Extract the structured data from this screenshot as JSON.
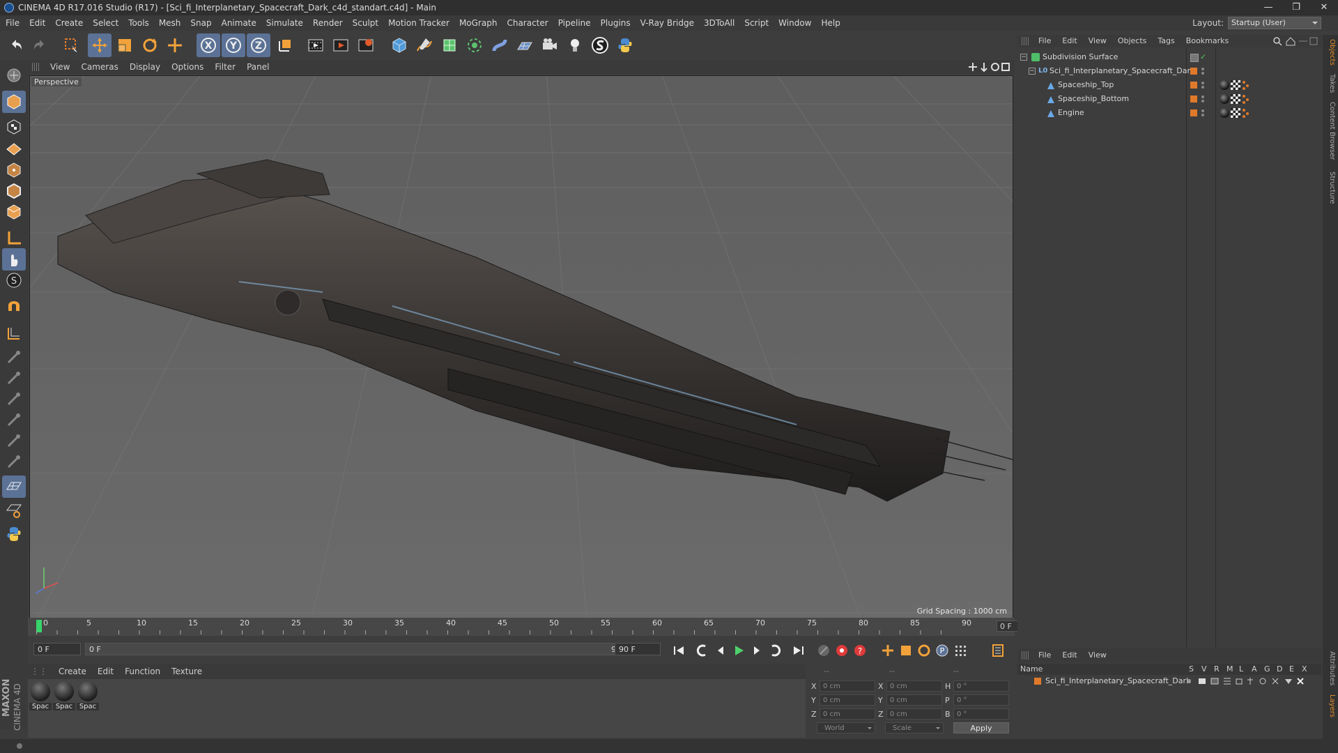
{
  "window": {
    "title": "CINEMA 4D R17.016 Studio (R17) - [Sci_fi_Interplanetary_Spacecraft_Dark_c4d_standart.c4d] - Main",
    "minimize_glyph": "—",
    "restore_glyph": "❐",
    "close_glyph": "✕"
  },
  "menu": [
    "File",
    "Edit",
    "Create",
    "Select",
    "Tools",
    "Mesh",
    "Snap",
    "Animate",
    "Simulate",
    "Render",
    "Sculpt",
    "Motion Tracker",
    "MoGraph",
    "Character",
    "Pipeline",
    "Plugins",
    "V-Ray Bridge",
    "3DToAll",
    "Script",
    "Window",
    "Help"
  ],
  "layout": {
    "label": "Layout:",
    "value": "Startup (User)"
  },
  "toolbar": {
    "axis_x": "X",
    "axis_y": "Y",
    "axis_z": "Z",
    "icons": [
      "undo-icon",
      "redo-icon",
      "live-selection-icon",
      "move-icon",
      "scale-icon",
      "rotate-icon",
      "last-tool-icon",
      "x-axis-icon",
      "y-axis-icon",
      "z-axis-icon",
      "coordinate-system-icon",
      "render-view-icon",
      "render-picture-viewer-icon",
      "edit-render-settings-icon",
      "cube-icon",
      "pen-spline-icon",
      "subdivision-surface-icon",
      "array-icon",
      "deformer-icon",
      "floor-icon",
      "camera-icon",
      "light-icon",
      "svg-plugin-icon",
      "python-icon"
    ]
  },
  "viewport": {
    "menu": [
      "View",
      "Cameras",
      "Display",
      "Options",
      "Filter",
      "Panel"
    ],
    "label": "Perspective",
    "grid_spacing": "Grid Spacing : 1000 cm"
  },
  "timeline": {
    "ticks": [
      "0",
      "5",
      "10",
      "15",
      "20",
      "25",
      "30",
      "35",
      "40",
      "45",
      "50",
      "55",
      "60",
      "65",
      "70",
      "75",
      "80",
      "85",
      "90"
    ],
    "current_frame": "0 F",
    "start_field": "0 F",
    "range_start": "0 F",
    "range_end": "90 F",
    "end_field": "90 F"
  },
  "materials": {
    "menu": [
      "Create",
      "Edit",
      "Function",
      "Texture"
    ],
    "items": [
      "Spac",
      "Spac",
      "Spac"
    ]
  },
  "coordinates": {
    "header_a": "--",
    "header_b": "--",
    "header_c": "--",
    "pos_labels": [
      "X",
      "Y",
      "Z"
    ],
    "pos_values": [
      "0 cm",
      "0 cm",
      "0 cm"
    ],
    "size_labels": [
      "X",
      "Y",
      "Z"
    ],
    "size_values": [
      "0 cm",
      "0 cm",
      "0 cm"
    ],
    "rot_labels": [
      "H",
      "P",
      "B"
    ],
    "rot_values": [
      "0 °",
      "0 °",
      "0 °"
    ],
    "mode": "World",
    "size_mode": "Scale",
    "apply": "Apply"
  },
  "objects": {
    "menu": [
      "File",
      "Edit",
      "View",
      "Objects",
      "Tags",
      "Bookmarks"
    ],
    "tree": [
      {
        "name": "Subdivision Surface",
        "level": 0
      },
      {
        "name": "Sci_fi_Interplanetary_Spacecraft_Dark",
        "level": 1,
        "prefix": "L0"
      },
      {
        "name": "Spaceship_Top",
        "level": 2
      },
      {
        "name": "Spaceship_Bottom",
        "level": 2
      },
      {
        "name": "Engine",
        "level": 2
      }
    ]
  },
  "layers": {
    "menu": [
      "File",
      "Edit",
      "View"
    ],
    "columns": [
      "Name",
      "S",
      "V",
      "R",
      "M",
      "L",
      "A",
      "G",
      "D",
      "E",
      "X"
    ],
    "rows": [
      {
        "name": "Sci_fi_Interplanetary_Spacecraft_Dark"
      }
    ]
  },
  "side_tabs": [
    "Objects",
    "Takes",
    "Content Browser",
    "Structure"
  ],
  "side_tabs_bottom": [
    "Attributes",
    "Layers"
  ],
  "branding": {
    "line1": "MAXON",
    "line2": "CINEMA 4D"
  },
  "colors": {
    "accent_blue": "#5b7296",
    "object_orange": "#e07a2a",
    "playhead_green": "#36d46a",
    "check_green": "#54c85a"
  }
}
